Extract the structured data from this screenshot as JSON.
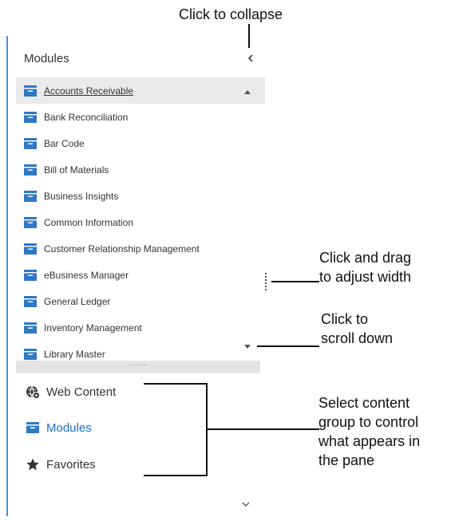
{
  "pane": {
    "title": "Modules",
    "modules": [
      {
        "label": "Accounts Receivable",
        "selected": true
      },
      {
        "label": "Bank Reconciliation",
        "selected": false
      },
      {
        "label": "Bar Code",
        "selected": false
      },
      {
        "label": "Bill of Materials",
        "selected": false
      },
      {
        "label": "Business Insights",
        "selected": false
      },
      {
        "label": "Common Information",
        "selected": false
      },
      {
        "label": "Customer Relationship Management",
        "selected": false
      },
      {
        "label": "eBusiness Manager",
        "selected": false
      },
      {
        "label": "General Ledger",
        "selected": false
      },
      {
        "label": "Inventory Management",
        "selected": false
      },
      {
        "label": "Library Master",
        "selected": false
      }
    ],
    "groups": [
      {
        "label": "Web Content",
        "icon": "globe-gear-icon",
        "active": false
      },
      {
        "label": "Modules",
        "icon": "module-icon",
        "active": true
      },
      {
        "label": "Favorites",
        "icon": "star-icon",
        "active": false
      }
    ],
    "splitter_dots": "......"
  },
  "callouts": {
    "collapse": "Click to collapse",
    "adjust_width": [
      "Click and drag",
      "to adjust width"
    ],
    "scroll_down": [
      "Click to",
      "scroll down"
    ],
    "content_group": [
      "Select content",
      "group to control",
      "what appears in",
      "the pane"
    ]
  },
  "colors": {
    "pane_border": "#4a8fd6",
    "module_icon": "#2f78c4",
    "active_group": "#1f6fbf",
    "selected_row": "#eaeaea",
    "splitter": "#e4e4e4"
  }
}
